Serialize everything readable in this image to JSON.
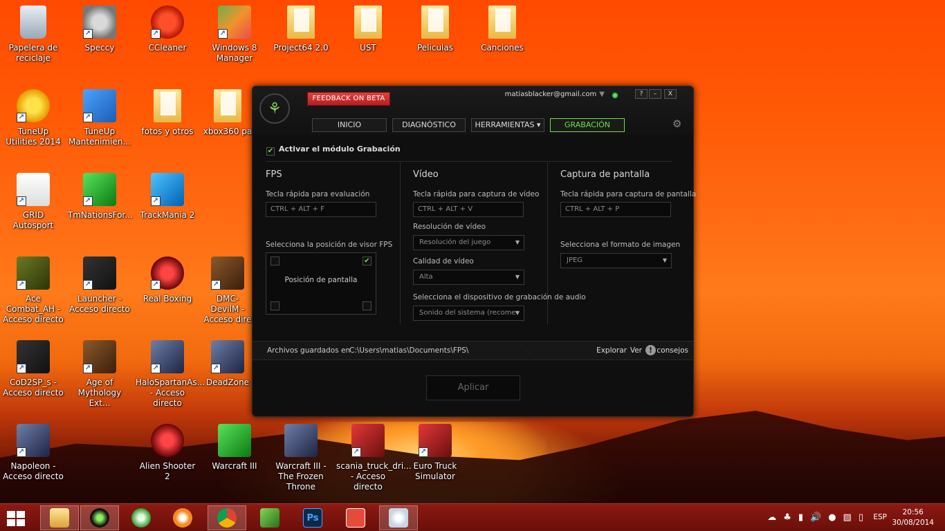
{
  "desktop": {
    "icons": [
      {
        "label": "Papelera de reciclaje"
      },
      {
        "label": "Speccy"
      },
      {
        "label": "CCleaner"
      },
      {
        "label": "Windows 8 Manager"
      },
      {
        "label": "Project64 2.0"
      },
      {
        "label": "UST"
      },
      {
        "label": "Peliculas"
      },
      {
        "label": "Canciones"
      },
      {
        "label": "TuneUp Utilities 2014"
      },
      {
        "label": "TuneUp Mantenimien..."
      },
      {
        "label": "fotos y otros"
      },
      {
        "label": "xbox360 pa"
      },
      {
        "label": "GRID Autosport"
      },
      {
        "label": "TmNationsFor..."
      },
      {
        "label": "TrackMania 2"
      },
      {
        "label": "Ace Combat_AH - Acceso directo"
      },
      {
        "label": "Launcher - Acceso directo"
      },
      {
        "label": "Real Boxing"
      },
      {
        "label": "DMC-DevilM - Acceso dire"
      },
      {
        "label": "CoD2SP_s - Acceso directo"
      },
      {
        "label": "Age of Mythology Ext..."
      },
      {
        "label": "HaloSpartanAs... - Acceso directo"
      },
      {
        "label": "DeadZone"
      },
      {
        "label": "Napoleon - Acceso directo"
      },
      {
        "label": "Alien Shooter 2"
      },
      {
        "label": "Warcraft III"
      },
      {
        "label": "Warcraft III - The Frozen Throne"
      },
      {
        "label": "scania_truck_dri... - Acceso directo"
      },
      {
        "label": "Euro Truck Simulator"
      }
    ]
  },
  "razer": {
    "logo_glyph": "⚘",
    "feedback": "FEEDBACK ON BETA",
    "account": "matiasblacker@gmail.com",
    "account_arrow": "▼",
    "win_buttons": {
      "help": "?",
      "minimize": "–",
      "close": "X"
    },
    "tabs": [
      {
        "label": "INICIO"
      },
      {
        "label": "DIAGNÓSTICO"
      },
      {
        "label": "HERRAMIENTAS ▾"
      },
      {
        "label": "GRABACIÓN"
      }
    ],
    "settings_glyph": "⚙",
    "check_glyph": "✔",
    "activate_label": "Activar el módulo Grabación",
    "fps": {
      "title": "FPS",
      "hotkey_label": "Tecla rápida para evaluación",
      "hotkey_value": "CTRL + ALT + F",
      "position_label": "Selecciona la posición de visor FPS",
      "position_box_label": "Posición de pantalla"
    },
    "video": {
      "title": "Vídeo",
      "hotkey_label": "Tecla rápida para captura de vídeo",
      "hotkey_value": "CTRL + ALT + V",
      "resolution_label": "Resolución de vídeo",
      "resolution_value": "Resolución del juego",
      "quality_label": "Calidad de vídeo",
      "quality_value": "Alta",
      "audio_label": "Selecciona el dispositivo de grabación de audio",
      "audio_value": "Sonido del sistema (recome"
    },
    "screenshot": {
      "title": "Captura de pantalla",
      "hotkey_label": "Tecla rápida para captura de pantalla",
      "hotkey_value": "CTRL + ALT + P",
      "format_label": "Selecciona el formato de imagen",
      "format_value": "JPEG"
    },
    "dropdown_arrow": "▼",
    "files_label": "Archivos guardados en",
    "files_path": "C:\\Users\\matias\\Documents\\FPS\\",
    "explore": "Explorar",
    "ver": "Ver",
    "info_glyph": "!",
    "tips": "consejos",
    "apply": "Aplicar"
  },
  "taskbar": {
    "items": [
      {
        "name": "file-explorer"
      },
      {
        "name": "razer-cortex"
      },
      {
        "name": "xbox-app"
      },
      {
        "name": "media-player"
      },
      {
        "name": "chrome"
      },
      {
        "name": "utility"
      },
      {
        "name": "photoshop",
        "text": "Ps"
      },
      {
        "name": "power-app"
      },
      {
        "name": "paint"
      }
    ],
    "lang": "ESP",
    "time": "20:56",
    "date": "30/08/2014",
    "tray_icons": [
      "☁",
      "♣",
      "▮",
      "🔊",
      "●",
      "▧",
      "▯"
    ]
  }
}
